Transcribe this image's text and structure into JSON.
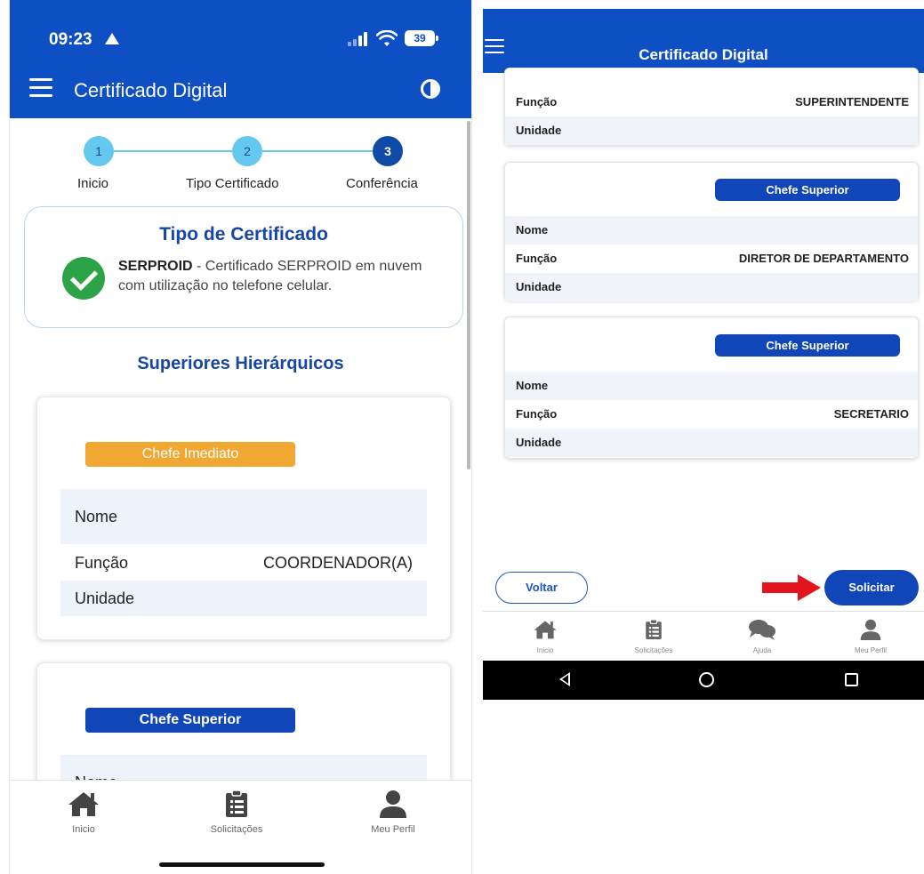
{
  "left": {
    "status": {
      "time": "09:23",
      "battery": "39"
    },
    "appbar": {
      "title": "Certificado Digital",
      "menu_icon": "hamburger-menu-icon",
      "contrast_icon": "contrast-toggle-icon"
    },
    "stepper": [
      {
        "number": "1",
        "label": "Inicio",
        "state": "done"
      },
      {
        "number": "2",
        "label": "Tipo Certificado",
        "state": "done"
      },
      {
        "number": "3",
        "label": "Conferência",
        "state": "current"
      }
    ],
    "certificate": {
      "title": "Tipo de Certificado",
      "name": "SERPROID",
      "description": " - Certificado SERPROID em nuvem com utilização no telefone celular."
    },
    "superiors_title": "Superiores Hierárquicos",
    "chief_immediate": {
      "badge": "Chefe Imediato",
      "rows": [
        {
          "label": "Nome",
          "value": ""
        },
        {
          "label": "Função",
          "value": "COORDENADOR(A)"
        },
        {
          "label": "Unidade",
          "value": ""
        }
      ]
    },
    "chief_superior": {
      "badge": "Chefe Superior",
      "rows": [
        {
          "label": "Nome",
          "value": ""
        }
      ]
    },
    "bottom_nav": [
      {
        "label": "Inicio",
        "icon": "home-icon"
      },
      {
        "label": "Solicitações",
        "icon": "clipboard-icon"
      },
      {
        "label": "Meu Perfil",
        "icon": "user-icon"
      }
    ]
  },
  "right": {
    "appbar": {
      "title": "Certificado Digital"
    },
    "top_card": {
      "rows": [
        {
          "label": "Função",
          "value": "SUPERINTENDENTE"
        },
        {
          "label": "Unidade",
          "value": ""
        }
      ]
    },
    "superior_cards": [
      {
        "badge": "Chefe Superior",
        "rows": [
          {
            "label": "Nome",
            "value": ""
          },
          {
            "label": "Função",
            "value": "DIRETOR DE DEPARTAMENTO"
          },
          {
            "label": "Unidade",
            "value": ""
          }
        ]
      },
      {
        "badge": "Chefe Superior",
        "rows": [
          {
            "label": "Nome",
            "value": ""
          },
          {
            "label": "Função",
            "value": "SECRETARIO"
          },
          {
            "label": "Unidade",
            "value": ""
          }
        ]
      }
    ],
    "actions": {
      "back": "Voltar",
      "submit": "Solicitar"
    },
    "bottom_nav": [
      {
        "label": "Inicio",
        "icon": "home-icon"
      },
      {
        "label": "Solicitações",
        "icon": "clipboard-icon"
      },
      {
        "label": "Ajuda",
        "icon": "chat-bubbles-icon"
      },
      {
        "label": "Meu Perfil",
        "icon": "user-icon"
      }
    ],
    "system_nav": [
      "back-icon",
      "home-circle-icon",
      "recent-apps-icon"
    ]
  },
  "colors": {
    "primary": "#0f4fc4",
    "step_light": "#64c8ef",
    "step_dark": "#0f4aa7",
    "badge_orange": "#f0a832",
    "badge_blue": "#1046b8",
    "success_green": "#2ba346",
    "arrow_red": "#e3141c"
  }
}
